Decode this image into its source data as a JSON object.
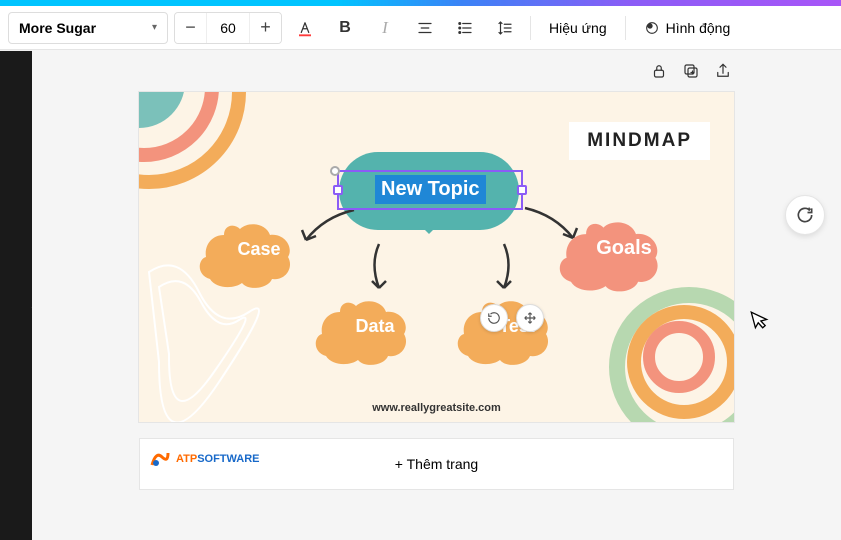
{
  "toolbar": {
    "font_name": "More Sugar",
    "font_size": "60",
    "effects_label": "Hiệu ứng",
    "animation_label": "Hình động"
  },
  "slide": {
    "label": "MINDMAP",
    "central_topic": "New Topic",
    "nodes": {
      "case": "Case",
      "goals": "Goals",
      "data": "Data",
      "test": "Test"
    },
    "website": "www.reallygreatsite.com"
  },
  "footer": {
    "add_page_label": "+ Thêm trang",
    "logo_atp": "ATP",
    "logo_soft": "SOFTWARE"
  },
  "colors": {
    "teal": "#54b3ad",
    "orange": "#f3ac5a",
    "coral": "#f3937d",
    "selection": "#8b5cf6"
  }
}
